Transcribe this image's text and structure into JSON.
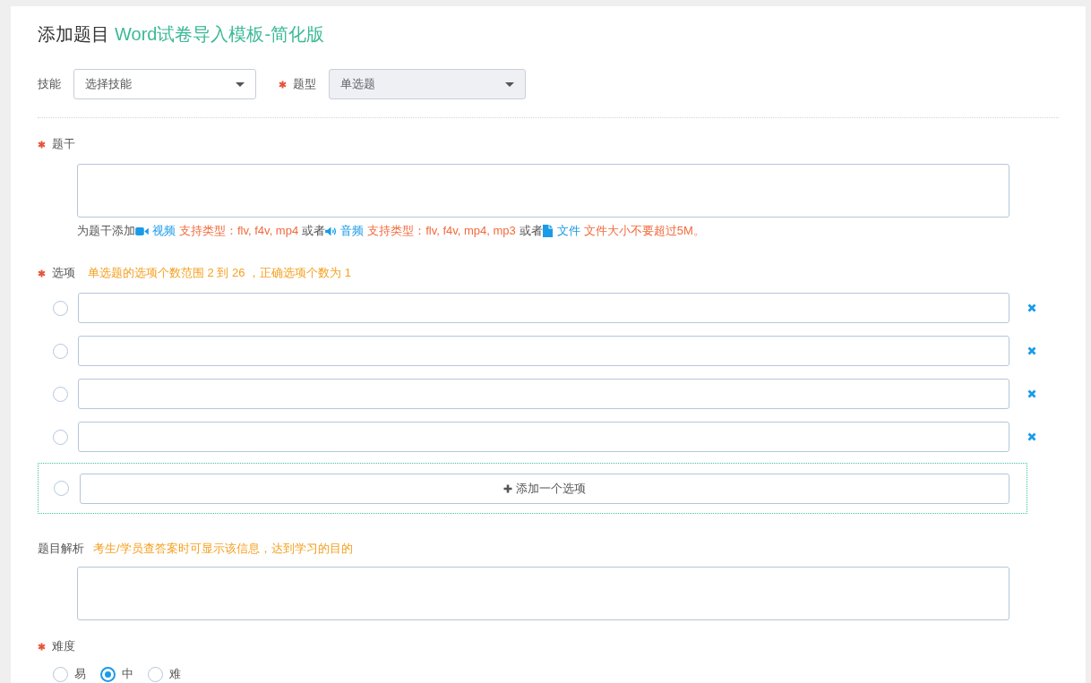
{
  "page": {
    "title": "添加题目",
    "subtitle": "Word试卷导入模板-简化版"
  },
  "filters": [
    {
      "label": "技能",
      "required": false,
      "placeholder": "选择技能",
      "disabled": false
    },
    {
      "label": "题型",
      "required": true,
      "value": "单选题",
      "disabled": true
    }
  ],
  "stem": {
    "label": "题干",
    "required": true,
    "help": [
      {
        "kind": "text",
        "text": "为题干添加"
      },
      {
        "kind": "video",
        "text": "视频"
      },
      {
        "kind": "note",
        "text": "支持类型：flv, f4v, mp4"
      },
      {
        "kind": "text",
        "text": "或者"
      },
      {
        "kind": "audio",
        "text": "音频"
      },
      {
        "kind": "note",
        "text": "支持类型：flv, f4v, mp4, mp3"
      },
      {
        "kind": "text",
        "text": "或者"
      },
      {
        "kind": "file",
        "text": "文件"
      },
      {
        "kind": "note",
        "text": "文件大小不要超过5M。"
      }
    ]
  },
  "options": {
    "label": "选项",
    "required": true,
    "hint": "单选题的选项个数范围 2 到 26 ，正确选项个数为 1",
    "items": [
      {
        "selected": false
      },
      {
        "selected": false
      },
      {
        "selected": false
      },
      {
        "selected": false
      }
    ],
    "add": {
      "label": "添加一个选项",
      "selected": false
    }
  },
  "analysis": {
    "label": "题目解析",
    "required": false,
    "hint": "考生/学员查答案时可显示该信息，达到学习的目的"
  },
  "difficulty": {
    "label": "难度",
    "required": true,
    "choices": [
      {
        "label": "易",
        "selected": false
      },
      {
        "label": "中",
        "selected": true
      },
      {
        "label": "难",
        "selected": false
      }
    ]
  }
}
